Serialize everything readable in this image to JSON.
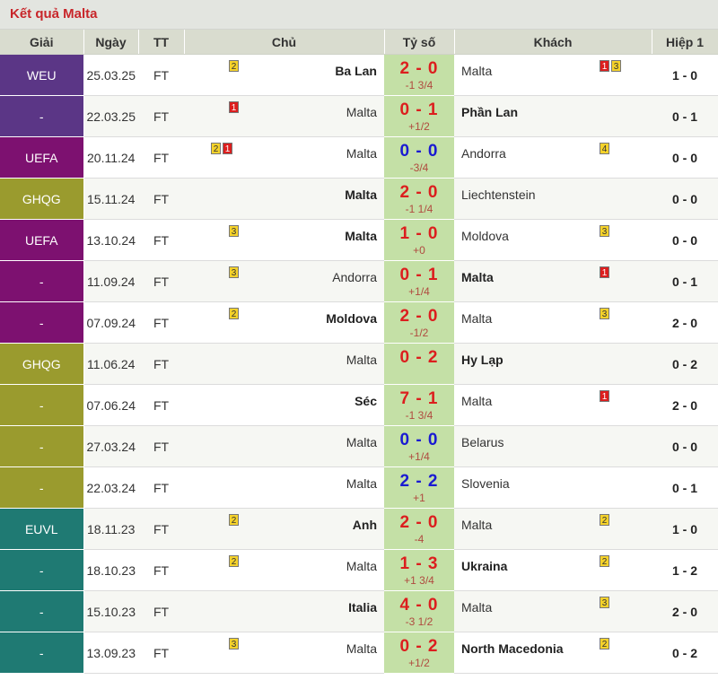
{
  "header": {
    "title": "Kết quả Malta"
  },
  "columns": [
    "Giải",
    "Ngày",
    "TT",
    "Chủ",
    "Tỷ số",
    "Khách",
    "Hiệp 1"
  ],
  "league_colors": {
    "purple": "#5b3686",
    "magenta": "#7d1170",
    "olive": "#9a9b2e",
    "teal": "#1f7a73"
  },
  "score_colors": {
    "red": "#dc1e1e",
    "blue": "#1a1ad2",
    "handicap": "#b04a3f",
    "score_bg": "#c4e0a6"
  },
  "matches": [
    {
      "league": "WEU",
      "date": "25.03.25",
      "status": "FT",
      "home": "Ba Lan",
      "home_bold": true,
      "home_cards": "2",
      "score": "2 - 0",
      "score_color": "red",
      "handicap": "-1 3/4",
      "away": "Malta",
      "away_bold": false,
      "away_cards": "1 3",
      "ht": "1 - 0"
    },
    {
      "league": "-",
      "date": "22.03.25",
      "status": "FT",
      "home": "Malta",
      "home_bold": false,
      "home_cards": "1",
      "score": "0 - 1",
      "score_color": "red",
      "handicap": "+1/2",
      "away": "Phần Lan",
      "away_bold": true,
      "away_cards": "",
      "ht": "0 - 1"
    },
    {
      "league": "UEFA",
      "date": "20.11.24",
      "status": "FT",
      "home": "Malta",
      "home_bold": false,
      "home_cards": "2 1",
      "score": "0 - 0",
      "score_color": "blue",
      "handicap": "-3/4",
      "away": "Andorra",
      "away_bold": false,
      "away_cards": "4",
      "ht": "0 - 0"
    },
    {
      "league": "GHQG",
      "date": "15.11.24",
      "status": "FT",
      "home": "Malta",
      "home_bold": true,
      "home_cards": "",
      "score": "2 - 0",
      "score_color": "red",
      "handicap": "-1 1/4",
      "away": "Liechtenstein",
      "away_bold": false,
      "away_cards": "",
      "ht": "0 - 0"
    },
    {
      "league": "UEFA",
      "date": "13.10.24",
      "status": "FT",
      "home": "Malta",
      "home_bold": true,
      "home_cards": "3",
      "score": "1 - 0",
      "score_color": "red",
      "handicap": "+0",
      "away": "Moldova",
      "away_bold": false,
      "away_cards": "3",
      "ht": "0 - 0"
    },
    {
      "league": "-",
      "date": "11.09.24",
      "status": "FT",
      "home": "Andorra",
      "home_bold": false,
      "home_cards": "3",
      "score": "0 - 1",
      "score_color": "red",
      "handicap": "+1/4",
      "away": "Malta",
      "away_bold": true,
      "away_cards": "1",
      "ht": "0 - 1"
    },
    {
      "league": "-",
      "date": "07.09.24",
      "status": "FT",
      "home": "Moldova",
      "home_bold": true,
      "home_cards": "2",
      "score": "2 - 0",
      "score_color": "red",
      "handicap": "-1/2",
      "away": "Malta",
      "away_bold": false,
      "away_cards": "3",
      "ht": "2 - 0"
    },
    {
      "league": "GHQG",
      "date": "11.06.24",
      "status": "FT",
      "home": "Malta",
      "home_bold": false,
      "home_cards": "",
      "score": "0 - 2",
      "score_color": "red",
      "handicap": "",
      "away": "Hy Lạp",
      "away_bold": true,
      "away_cards": "",
      "ht": "0 - 2"
    },
    {
      "league": "-",
      "date": "07.06.24",
      "status": "FT",
      "home": "Séc",
      "home_bold": true,
      "home_cards": "",
      "score": "7 - 1",
      "score_color": "red",
      "handicap": "-1 3/4",
      "away": "Malta",
      "away_bold": false,
      "away_cards": "1",
      "ht": "2 - 0"
    },
    {
      "league": "-",
      "date": "27.03.24",
      "status": "FT",
      "home": "Malta",
      "home_bold": false,
      "home_cards": "",
      "score": "0 - 0",
      "score_color": "blue",
      "handicap": "+1/4",
      "away": "Belarus",
      "away_bold": false,
      "away_cards": "",
      "ht": "0 - 0"
    },
    {
      "league": "-",
      "date": "22.03.24",
      "status": "FT",
      "home": "Malta",
      "home_bold": false,
      "home_cards": "",
      "score": "2 - 2",
      "score_color": "blue",
      "handicap": "+1",
      "away": "Slovenia",
      "away_bold": false,
      "away_cards": "",
      "ht": "0 - 1"
    },
    {
      "league": "EUVL",
      "date": "18.11.23",
      "status": "FT",
      "home": "Anh",
      "home_bold": true,
      "home_cards": "2",
      "score": "2 - 0",
      "score_color": "red",
      "handicap": "-4",
      "away": "Malta",
      "away_bold": false,
      "away_cards": "2",
      "ht": "1 - 0"
    },
    {
      "league": "-",
      "date": "18.10.23",
      "status": "FT",
      "home": "Malta",
      "home_bold": false,
      "home_cards": "2",
      "score": "1 - 3",
      "score_color": "red",
      "handicap": "+1 3/4",
      "away": "Ukraina",
      "away_bold": true,
      "away_cards": "2",
      "ht": "1 - 2"
    },
    {
      "league": "-",
      "date": "15.10.23",
      "status": "FT",
      "home": "Italia",
      "home_bold": true,
      "home_cards": "",
      "score": "4 - 0",
      "score_color": "red",
      "handicap": "-3 1/2",
      "away": "Malta",
      "away_bold": false,
      "away_cards": "3",
      "ht": "2 - 0"
    },
    {
      "league": "-",
      "date": "13.09.23",
      "status": "FT",
      "home": "Malta",
      "home_bold": false,
      "home_cards": "3",
      "score": "0 - 2",
      "score_color": "red",
      "handicap": "+1/2",
      "away": "North Macedonia",
      "away_bold": true,
      "away_cards": "2",
      "ht": "0 - 2"
    }
  ]
}
